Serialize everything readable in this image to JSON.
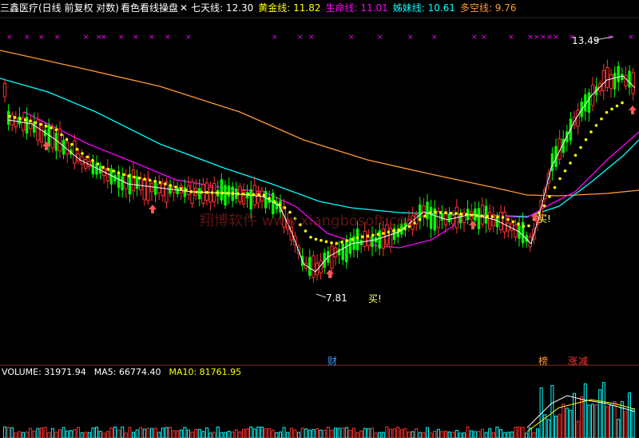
{
  "header": {
    "stock_name": "三鑫医疗(日线 前复权 对数)",
    "indicator_name": "看色看线操盘",
    "close_icon": "x-icon",
    "ma7_label": "七天线: 12.30",
    "gold_label": "黄金线: 11.82",
    "life_label": "生命线: 11.01",
    "sister_label": "姊妹线: 10.61",
    "trend_label": "多空线: 9.76"
  },
  "annotations": {
    "high_label": "13.49",
    "low_label": "7.81",
    "buy1": "买!",
    "buy2": "买!",
    "watermark": "翔博软件  www.xiangbosoft.com",
    "event_cai": "财",
    "event_bang": "榜",
    "event_zhang": "涨",
    "event_jian": "减"
  },
  "volume_header": {
    "volume": "VOLUME: 31971.94",
    "ma5": "MA5: 66774.40",
    "ma10": "MA10: 81761.95"
  },
  "colors": {
    "ma7": "#ffffff",
    "gold": "#ffff00",
    "life": "#ff00ff",
    "sister": "#00ffff",
    "trend": "#ff9933",
    "up": "#ff3333",
    "down": "#00ff00",
    "event_cai": "#3399ff",
    "event_bang": "#ff9933",
    "event_zhang": "#ff3333",
    "event_jian": "#ff3333",
    "arrow": "#ff5555",
    "cross": "#ff00ff"
  },
  "chart_data": {
    "type": "candlestick",
    "price_high": 13.49,
    "price_low": 7.81,
    "last_close_ma": {
      "ma7": 12.3,
      "gold": 11.82,
      "life": 11.01,
      "sister": 10.61,
      "trend": 9.76
    }
  }
}
